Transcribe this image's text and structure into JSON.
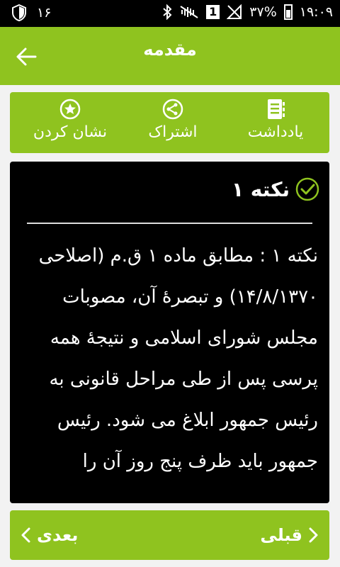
{
  "status_bar": {
    "notification_count": "۱۶",
    "battery_percent": "۳۷%",
    "time": "۱۹:۰۹",
    "sim_badge": "1"
  },
  "app_bar": {
    "title": "مقدمه"
  },
  "actions": {
    "bookmark_label": "نشان کردن",
    "share_label": "اشتراک",
    "note_label": "یادداشت"
  },
  "content": {
    "note_title": "نکته ۱",
    "body": "نکته ۱ : مطابق ماده ۱ ق.م (اصلاحی ۱۴/۸/۱۳۷۰) و تبصرهٔ آن، مصوبات مجلس شورای اسلامی و نتیجهٔ همه پرسی پس از طی مراحل قانونی به رئیس جمهور ابلاغ می شود. رئیس جمهور باید ظرف پنج روز آن را"
  },
  "bottom_nav": {
    "next_label": "بعدی",
    "prev_label": "قبلی"
  },
  "colors": {
    "accent": "#8fc31f",
    "content_bg": "#000000",
    "page_bg": "#f2f2f2"
  }
}
